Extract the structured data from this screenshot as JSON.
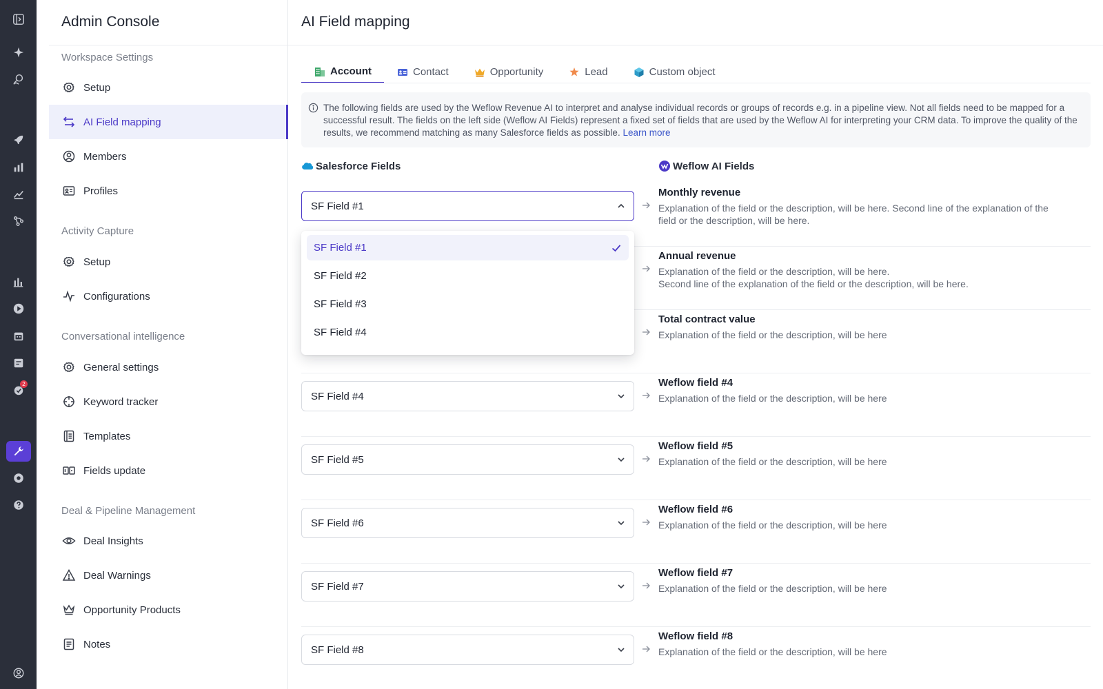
{
  "rail": {
    "badge_count": "2",
    "colors": {
      "background": "#2b2f3a",
      "active": "#5b3fd6",
      "badge": "#e0394b"
    },
    "icons": [
      "sidebar-toggle-icon",
      "sparkle-icon",
      "search-people-icon",
      "rocket-icon",
      "chart-icon",
      "trend-icon",
      "flow-icon",
      "bar-chart-icon",
      "play-icon",
      "calendar-icon",
      "note-icon",
      "task-icon",
      "wrench-icon",
      "gear-icon",
      "help-icon",
      "user-icon"
    ]
  },
  "sidebar": {
    "title": "Admin Console",
    "sections": [
      {
        "label": "Workspace Settings",
        "items": [
          {
            "label": "Setup",
            "icon": "gear-icon"
          },
          {
            "label": "AI Field mapping",
            "icon": "swap-icon",
            "active": true
          },
          {
            "label": "Members",
            "icon": "user-circle-icon"
          },
          {
            "label": "Profiles",
            "icon": "id-card-icon"
          }
        ]
      },
      {
        "label": "Activity Capture",
        "items": [
          {
            "label": "Setup",
            "icon": "gear-icon"
          },
          {
            "label": "Configurations",
            "icon": "pulse-icon"
          }
        ]
      },
      {
        "label": "Conversational intelligence",
        "items": [
          {
            "label": "General settings",
            "icon": "gear-icon"
          },
          {
            "label": "Keyword tracker",
            "icon": "crosshair-icon"
          },
          {
            "label": "Templates",
            "icon": "template-icon"
          },
          {
            "label": "Fields update",
            "icon": "fields-icon"
          }
        ]
      },
      {
        "label": "Deal & Pipeline Management",
        "items": [
          {
            "label": "Deal Insights",
            "icon": "eye-icon"
          },
          {
            "label": "Deal Warnings",
            "icon": "warning-icon"
          },
          {
            "label": "Opportunity Products",
            "icon": "crown-icon"
          },
          {
            "label": "Notes",
            "icon": "notes-icon"
          }
        ]
      }
    ]
  },
  "main": {
    "title": "AI Field mapping",
    "tabs": [
      {
        "label": "Account",
        "active": true,
        "icon": "building-icon"
      },
      {
        "label": "Contact",
        "icon": "contact-card-icon"
      },
      {
        "label": "Opportunity",
        "icon": "crown-icon"
      },
      {
        "label": "Lead",
        "icon": "person-star-icon"
      },
      {
        "label": "Custom object",
        "icon": "cube-icon"
      }
    ],
    "info": {
      "text": "The following fields are used by the Weflow Revenue AI to interpret and analyse individual records or groups of records e.g. in a pipeline view. Not all fields need to be mapped for a successful result. The fields on the left side (Weflow AI Fields) represent a fixed set of fields that are used by the Weflow AI for interpreting your CRM data. To improve the quality of the results, we recommend matching as many Salesforce fields as possible.",
      "link": "Learn more"
    },
    "columns": {
      "left": "Salesforce Fields",
      "right": "Weflow AI Fields"
    },
    "rows": [
      {
        "select": "SF Field #1",
        "open": true,
        "field": "Monthly revenue",
        "desc": "Explanation of the field or the description, will be here. Second line of the explanation of the field or the description, will be here."
      },
      {
        "select": "",
        "field": "Annual revenue",
        "desc_line1": "Explanation of the field or the description, will be here.",
        "desc_line2": "Second line of the explanation of the field or the description, will be here."
      },
      {
        "select": "",
        "field": "Total contract value",
        "desc": "Explanation of the field or the description, will be here"
      },
      {
        "select": "SF Field #4",
        "field": "Weflow field #4",
        "desc": "Explanation of the field or the description, will be here"
      },
      {
        "select": "SF Field #5",
        "field": "Weflow field #5",
        "desc": "Explanation of the field or the description, will be here"
      },
      {
        "select": "SF Field #6",
        "field": "Weflow field #6",
        "desc": "Explanation of the field or the description, will be here"
      },
      {
        "select": "SF Field #7",
        "field": "Weflow field #7",
        "desc": "Explanation of the field or the description, will be here"
      },
      {
        "select": "SF Field #8",
        "field": "Weflow field #8",
        "desc": "Explanation of the field or the description, will be here"
      }
    ],
    "dropdown": {
      "options": [
        "SF Field #1",
        "SF Field #2",
        "SF Field #3",
        "SF Field #4"
      ],
      "selected": "SF Field #1"
    },
    "colors": {
      "accent": "#4b39c7",
      "link": "#3b56c9",
      "salesforce": "#1798d6"
    }
  }
}
